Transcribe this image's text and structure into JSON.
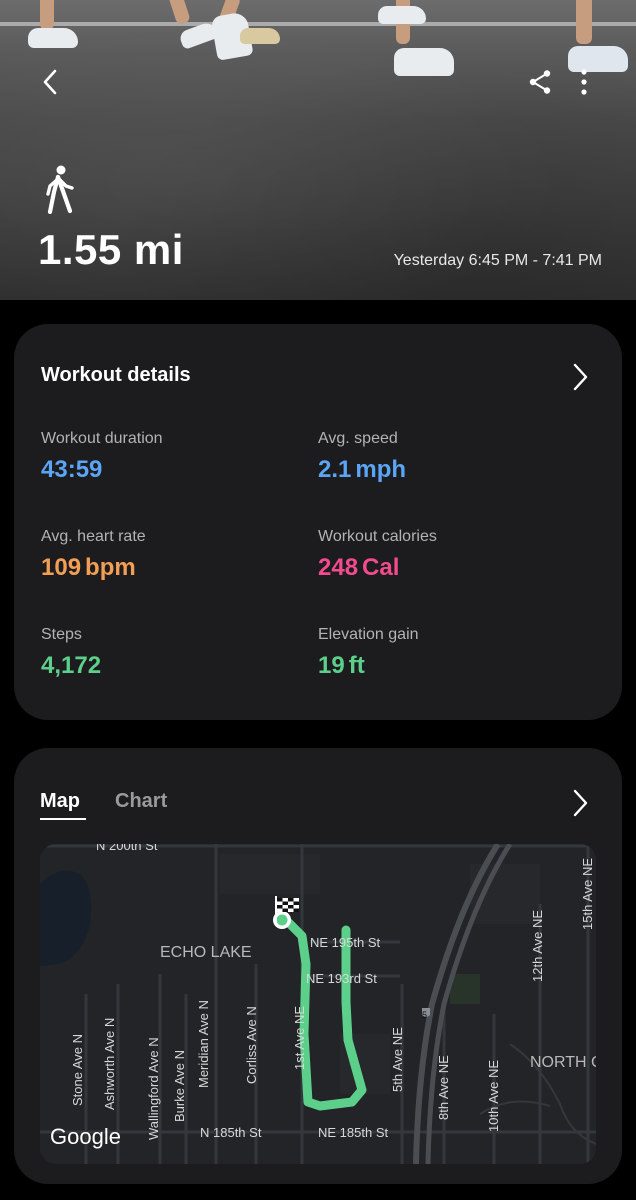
{
  "header": {
    "back_icon": "chevron-left-icon",
    "share_icon": "share-icon",
    "more_icon": "more-vertical-icon",
    "activity_icon": "walking-icon",
    "distance_value": "1.55",
    "distance_unit": "mi",
    "time_range": "Yesterday 6:45 PM - 7:41 PM"
  },
  "details": {
    "title": "Workout details",
    "stats": {
      "duration": {
        "label": "Workout duration",
        "value": "43:59",
        "unit": "",
        "color": "#5aa5f5"
      },
      "speed": {
        "label": "Avg. speed",
        "value": "2.1",
        "unit": "mph",
        "color": "#5aa5f5"
      },
      "heart_rate": {
        "label": "Avg. heart rate",
        "value": "109",
        "unit": "bpm",
        "color": "#f39e55"
      },
      "calories": {
        "label": "Workout calories",
        "value": "248",
        "unit": "Cal",
        "color": "#f24b8f"
      },
      "steps": {
        "label": "Steps",
        "value": "4,172",
        "unit": "",
        "color": "#5cd08b"
      },
      "elevation": {
        "label": "Elevation gain",
        "value": "19",
        "unit": "ft",
        "color": "#5cd08b"
      }
    }
  },
  "map_card": {
    "tabs": [
      {
        "label": "Map",
        "active": true
      },
      {
        "label": "Chart",
        "active": false
      }
    ],
    "map": {
      "attribution": "Google",
      "route_color": "#5cd08b",
      "labels": {
        "top_street": "N 200th St",
        "area_echo_lake": "ECHO LAKE",
        "area_north": "NORTH C",
        "ne_195th": "NE 195th St",
        "ne_193rd": "NE 193rd St",
        "n_185th": "N 185th St",
        "ne_185th": "NE 185th St",
        "stone": "Stone Ave N",
        "ashworth": "Ashworth Ave N",
        "wallingford": "Wallingford Ave N",
        "burke": "Burke Ave N",
        "meridian": "Meridian Ave N",
        "corliss": "Corliss Ave N",
        "first_ave": "1st Ave NE",
        "fifth_ave": "5th Ave NE",
        "eighth_ave": "8th Ave NE",
        "tenth_ave": "10th Ave NE",
        "twelfth_ave": "12th Ave NE",
        "fifteenth_ave": "15th Ave NE",
        "interstate": "5"
      }
    }
  }
}
